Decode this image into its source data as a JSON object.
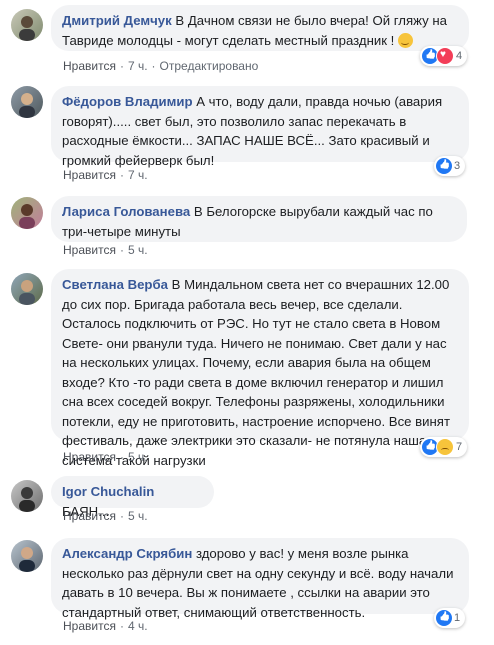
{
  "comments": [
    {
      "author": "Дмитрий Демчук",
      "lines": [
        "В Дачном связи не было вчера! Ой гляжу на",
        "Тавриде молодцы - могут сделать местный праздник !"
      ],
      "like_label": "Нравится",
      "time": "7 ч.",
      "edited": "Отредактировано",
      "reaction_count": "4",
      "reactions": [
        "like-icon",
        "love-icon"
      ],
      "emoji": "smile-emoji"
    },
    {
      "author": "Фёдоров Владимир",
      "lines": [
        "А что, воду дали, правда ночью (авария",
        "говорят)..... свет был, это позволило запас перекачать в",
        "расходные ёмкости... ЗАПАС НАШЕ ВСЁ... Зато красивый и",
        "громкий фейерверк был!"
      ],
      "like_label": "Нравится",
      "time": "7 ч.",
      "reaction_count": "3",
      "reactions": [
        "like-icon"
      ]
    },
    {
      "author": "Лариса Голованева",
      "lines": [
        "В Белогорске вырубали каждый час по",
        "три-четыре минуты"
      ],
      "like_label": "Нравится",
      "time": "5 ч."
    },
    {
      "author": "Светлана Верба",
      "lines": [
        "В Миндальном света нет со вчерашних 12.00",
        "до сих пор. Бригада работала весь вечер, все сделали.",
        "Осталось подключить от РЭС. Но тут не стало света в Новом",
        "Свете- они рванули туда. Ничего не понимаю. Свет дали у нас",
        "на нескольких улицах. Почему, если авария была на общем",
        "входе? Кто -то ради света в доме включил генератор и лишил",
        "сна всех соседей вокруг. Телефоны разряжены, холодильники",
        "потекли, еду не приготовить, настроение испорчено. Все винят",
        "фестиваль, даже электрики это сказали- не потянула наша",
        "система такой нагрузки"
      ],
      "like_label": "Нравится",
      "time": "5 ч.",
      "reaction_count": "7",
      "reactions": [
        "like-icon",
        "sad-icon"
      ]
    },
    {
      "author": "Igor Chuchalin",
      "lines": [
        "БАЯН..."
      ],
      "like_label": "Нравится",
      "time": "5 ч."
    },
    {
      "author": "Александр Скрябин",
      "lines": [
        "здорово у вас! у меня возле рынка",
        "несколько раз дёрнули свет на одну секунду и всё. воду начали",
        "давать в 10 вечера. Вы ж понимаете , ссылки на аварии это",
        "стандартный ответ, снимающий ответственность."
      ],
      "like_label": "Нравится",
      "time": "4 ч.",
      "reaction_count": "1",
      "reactions": [
        "like-icon"
      ]
    }
  ],
  "colors": {
    "author": "#385898",
    "bubble": "#f2f3f5",
    "meta": "#606770",
    "like": "#2078f4",
    "love": "#f33e58",
    "sad": "#f7c43b"
  }
}
